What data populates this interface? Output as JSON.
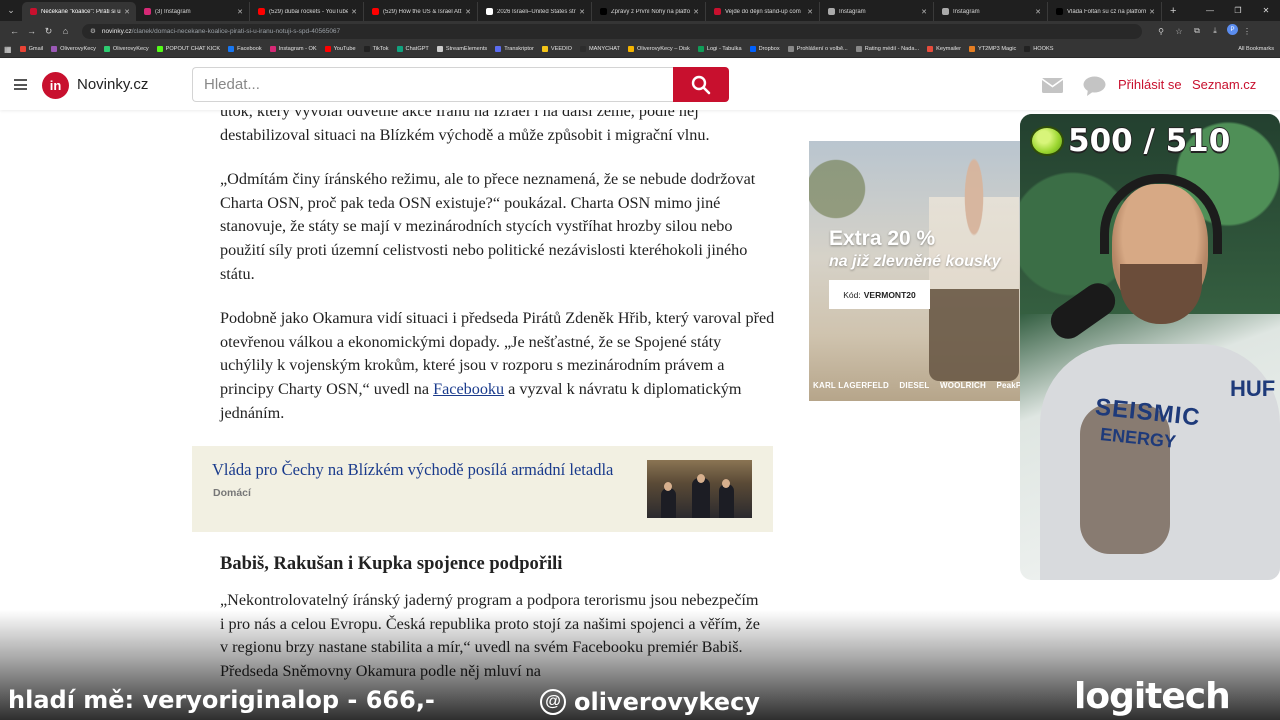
{
  "browser": {
    "tabs": [
      {
        "title": "Nečekané \"koalice\": Piráti si u",
        "color": "#c8102e",
        "active": true
      },
      {
        "title": "(3) Instagram",
        "color": "#d62976",
        "active": false
      },
      {
        "title": "(529) dubai rockets - YouTube",
        "color": "#ff0000",
        "active": false
      },
      {
        "title": "(529) How the US & Israel Att",
        "color": "#ff0000",
        "active": false
      },
      {
        "title": "2026 Israeli–United States str",
        "color": "#ffffff",
        "active": false
      },
      {
        "title": "Zprávy z První Nohy na platfo",
        "color": "#000000",
        "active": false
      },
      {
        "title": "Vejde do dějin stand-up com",
        "color": "#c8102e",
        "active": false
      },
      {
        "title": "Instagram",
        "color": "#aaaaaa",
        "active": false
      },
      {
        "title": "Instagram",
        "color": "#aaaaaa",
        "active": false
      },
      {
        "title": "Vláda Foltán su cz na platform",
        "color": "#000000",
        "active": false
      }
    ],
    "new_tab": "+",
    "url_host": "novinky.cz",
    "url_path": "/clanek/domaci-necekane-koalice-pirati-si-u-iranu-notuji-s-spd-40565067",
    "bookmarks": [
      {
        "label": "Gmail",
        "color": "#ea4335"
      },
      {
        "label": "OliverovyKecy",
        "color": "#9b59b6"
      },
      {
        "label": "OliverovyKecy",
        "color": "#2ecc71"
      },
      {
        "label": "POPOUT CHAT KICK",
        "color": "#53fc18"
      },
      {
        "label": "Facebook",
        "color": "#1877f2"
      },
      {
        "label": "Instagram - OK",
        "color": "#d62976"
      },
      {
        "label": "YouTube",
        "color": "#ff0000"
      },
      {
        "label": "TikTok",
        "color": "#222222"
      },
      {
        "label": "ChatGPT",
        "color": "#10a37f"
      },
      {
        "label": "StreamElements",
        "color": "#cccccc"
      },
      {
        "label": "Transkriptor",
        "color": "#5b6cf0"
      },
      {
        "label": "VEEDIO",
        "color": "#f5c518"
      },
      {
        "label": "MANYCHAT",
        "color": "#2d2d2d"
      },
      {
        "label": "OliverovyKecy – Disk",
        "color": "#f4b400"
      },
      {
        "label": "Logi - Tabulka",
        "color": "#0f9d58"
      },
      {
        "label": "Dropbox",
        "color": "#0061ff"
      },
      {
        "label": "Prohlášení o volbě...",
        "color": "#888888"
      },
      {
        "label": "Rating médií - Nada...",
        "color": "#888888"
      },
      {
        "label": "Keymailer",
        "color": "#e74c3c"
      },
      {
        "label": "YT2MP3 Magic",
        "color": "#e67e22"
      },
      {
        "label": "HOOKS",
        "color": "#222222"
      }
    ],
    "all_bookmarks": "All Bookmarks"
  },
  "site": {
    "logo_badge": "in",
    "logo_name": "Novinky.cz",
    "search_placeholder": "Hledat...",
    "login": "Přihlásit se",
    "seznam": "Seznam.cz"
  },
  "article": {
    "p0": "útok, který vyvolal odvetné akce Íránu na Izrael i na další země, podle něj destabilizoval situaci na Blízkém východě a může způsobit i migrační vlnu.",
    "p1": "„Odmítám činy íránského režimu, ale to přece neznamená, že se nebude dodržovat Charta OSN, proč pak teda OSN existuje?“ poukázal. Charta OSN mimo jiné stanovuje, že státy se mají v mezinárodních stycích vystříhat hrozby silou nebo použití síly proti územní celistvosti nebo politické nezávislosti kteréhokoli jiného státu.",
    "p2_before": "Podobně jako Okamura vidí situaci i předseda Pirátů Zdeněk Hřib, který varoval před otevřenou válkou a ekonomickými dopady. „Je nešťastné, že se Spojené státy uchýlily k vojenským krokům, které jsou v rozporu s mezinárodním právem a principy Charty OSN,“ uvedl na ",
    "p2_link": "Facebooku",
    "p2_after": " a vyzval k návratu k diplomatickým jednáním.",
    "related_title": "Vláda pro Čechy na Blízkém východě posílá armádní letadla",
    "related_category": "Domácí",
    "section_heading": "Babiš, Rakušan i Kupka spojence podpořili",
    "p3": "„Nekontrolovatelný íránský jaderný program a podpora terorismu jsou nebezpečím i pro nás a celou Evropu. Česká republika proto stojí za našimi spojenci a věřím, že v regionu brzy nastane stabilita a mír,“ uvedl na svém Facebooku premiér Babiš. Předseda Sněmovny Okamura podle něj mluví na"
  },
  "ad": {
    "headline": "Extra 20 %",
    "subline": "na již zlevněné kousky",
    "code_label": "Kód:",
    "code_value": "VERMONT20",
    "brands": [
      "KARL LAGERFELD",
      "DIESEL",
      "WOOLRICH",
      "PeakPerforman"
    ]
  },
  "overlay": {
    "points": "500 / 510",
    "ticker": "hladí mě: veryoriginalop - 666,-",
    "threads_handle": "oliverovykecy",
    "sponsor": "logitech",
    "shirt_line1": "SEISMIC",
    "shirt_line2": "ENERGY",
    "shirt_side": "HUF"
  }
}
